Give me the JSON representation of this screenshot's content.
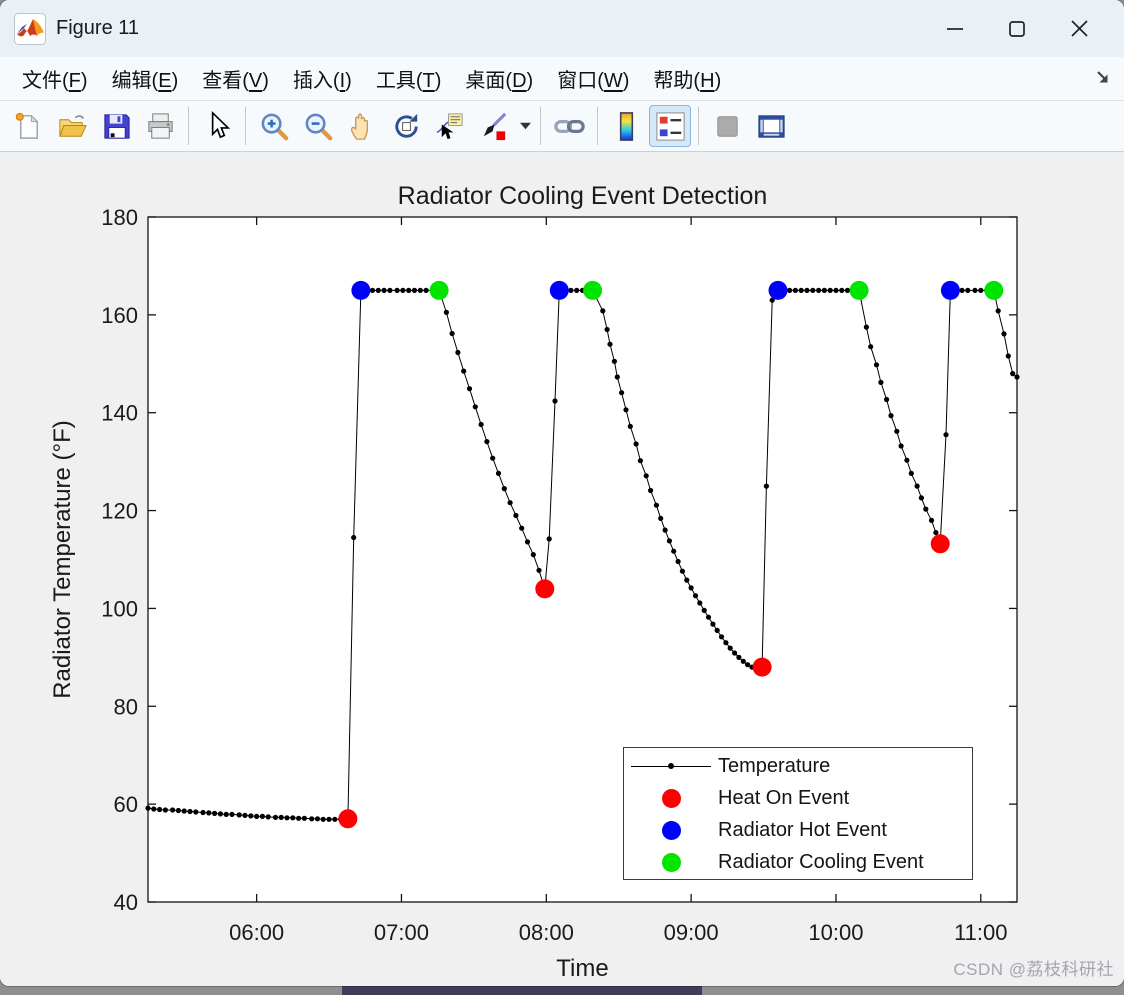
{
  "window": {
    "title": "Figure 11"
  },
  "menubar": {
    "items": [
      {
        "label": "文件(F)"
      },
      {
        "label": "编辑(E)"
      },
      {
        "label": "查看(V)"
      },
      {
        "label": "插入(I)"
      },
      {
        "label": "工具(T)"
      },
      {
        "label": "桌面(D)"
      },
      {
        "label": "窗口(W)"
      },
      {
        "label": "帮助(H)"
      }
    ]
  },
  "toolbar": {
    "items": [
      {
        "name": "new-figure-icon"
      },
      {
        "name": "open-file-icon"
      },
      {
        "name": "save-figure-icon"
      },
      {
        "name": "print-figure-icon"
      },
      {
        "type": "separator"
      },
      {
        "name": "edit-plot-cursor-icon"
      },
      {
        "type": "separator"
      },
      {
        "name": "zoom-in-icon"
      },
      {
        "name": "zoom-out-icon"
      },
      {
        "name": "pan-icon"
      },
      {
        "name": "rotate-3d-icon"
      },
      {
        "name": "data-cursor-icon"
      },
      {
        "name": "brush-data-icon"
      },
      {
        "name": "brush-dropdown-caret-icon",
        "narrow": true
      },
      {
        "type": "separator"
      },
      {
        "name": "link-plot-icon"
      },
      {
        "type": "separator"
      },
      {
        "name": "insert-colorbar-icon"
      },
      {
        "name": "insert-legend-icon",
        "selected": true
      },
      {
        "type": "separator"
      },
      {
        "name": "hide-plot-tools-icon",
        "disabled": true
      },
      {
        "name": "dock-figure-tools-icon"
      }
    ],
    "selected_highlight_color": "#d5e7f8"
  },
  "watermark": "CSDN @荔枝科研社",
  "chart_data": {
    "type": "line",
    "title": "Radiator Cooling Event Detection",
    "xlabel": "Time",
    "ylabel": "Radiator Temperature (°F)",
    "x_range_hours": [
      5.25,
      11.25
    ],
    "ylim": [
      40,
      180
    ],
    "grid": false,
    "legend_position": "lower-right-inside",
    "x_ticks": [
      {
        "hour": 6,
        "label": "06:00"
      },
      {
        "hour": 7,
        "label": "07:00"
      },
      {
        "hour": 8,
        "label": "08:00"
      },
      {
        "hour": 9,
        "label": "09:00"
      },
      {
        "hour": 10,
        "label": "10:00"
      },
      {
        "hour": 11,
        "label": "11:00"
      }
    ],
    "y_ticks": [
      40,
      60,
      80,
      100,
      120,
      140,
      160,
      180
    ],
    "series": [
      {
        "name": "Temperature",
        "type": "line-with-dots",
        "color": "#000000",
        "points": [
          [
            5.25,
            59.2
          ],
          [
            5.29,
            59.0
          ],
          [
            5.33,
            58.9
          ],
          [
            5.37,
            58.8
          ],
          [
            5.42,
            58.8
          ],
          [
            5.46,
            58.7
          ],
          [
            5.5,
            58.6
          ],
          [
            5.54,
            58.5
          ],
          [
            5.58,
            58.4
          ],
          [
            5.63,
            58.3
          ],
          [
            5.67,
            58.2
          ],
          [
            5.71,
            58.1
          ],
          [
            5.75,
            58.0
          ],
          [
            5.79,
            57.9
          ],
          [
            5.83,
            57.9
          ],
          [
            5.88,
            57.8
          ],
          [
            5.92,
            57.7
          ],
          [
            5.96,
            57.6
          ],
          [
            6.0,
            57.5
          ],
          [
            6.04,
            57.5
          ],
          [
            6.08,
            57.4
          ],
          [
            6.13,
            57.3
          ],
          [
            6.17,
            57.3
          ],
          [
            6.21,
            57.2
          ],
          [
            6.25,
            57.2
          ],
          [
            6.29,
            57.1
          ],
          [
            6.33,
            57.1
          ],
          [
            6.38,
            57.0
          ],
          [
            6.42,
            57.0
          ],
          [
            6.46,
            56.9
          ],
          [
            6.5,
            56.9
          ],
          [
            6.54,
            56.9
          ],
          [
            6.58,
            56.9
          ],
          [
            6.63,
            57.0
          ],
          [
            6.67,
            114.5
          ],
          [
            6.72,
            165
          ],
          [
            6.76,
            165
          ],
          [
            6.8,
            165
          ],
          [
            6.84,
            165
          ],
          [
            6.88,
            165
          ],
          [
            6.92,
            165
          ],
          [
            6.97,
            165
          ],
          [
            7.01,
            165
          ],
          [
            7.05,
            165
          ],
          [
            7.09,
            165
          ],
          [
            7.13,
            165
          ],
          [
            7.17,
            165
          ],
          [
            7.22,
            165
          ],
          [
            7.26,
            165
          ],
          [
            7.31,
            160.5
          ],
          [
            7.35,
            156.2
          ],
          [
            7.39,
            152.3
          ],
          [
            7.43,
            148.5
          ],
          [
            7.47,
            144.9
          ],
          [
            7.51,
            141.2
          ],
          [
            7.55,
            137.6
          ],
          [
            7.59,
            134.1
          ],
          [
            7.63,
            130.7
          ],
          [
            7.67,
            127.6
          ],
          [
            7.71,
            124.5
          ],
          [
            7.75,
            121.6
          ],
          [
            7.79,
            119.0
          ],
          [
            7.83,
            116.4
          ],
          [
            7.87,
            113.6
          ],
          [
            7.91,
            111.0
          ],
          [
            7.95,
            107.8
          ],
          [
            7.99,
            104.0
          ],
          [
            8.02,
            114.2
          ],
          [
            8.06,
            142.4
          ],
          [
            8.09,
            165
          ],
          [
            8.13,
            165
          ],
          [
            8.17,
            165
          ],
          [
            8.21,
            165
          ],
          [
            8.25,
            165
          ],
          [
            8.28,
            165
          ],
          [
            8.32,
            165
          ],
          [
            8.39,
            160.8
          ],
          [
            8.42,
            157.0
          ],
          [
            8.44,
            154.0
          ],
          [
            8.47,
            150.5
          ],
          [
            8.49,
            147.3
          ],
          [
            8.52,
            144.1
          ],
          [
            8.55,
            140.6
          ],
          [
            8.58,
            137.2
          ],
          [
            8.62,
            133.6
          ],
          [
            8.65,
            130.2
          ],
          [
            8.69,
            127.1
          ],
          [
            8.72,
            124.1
          ],
          [
            8.76,
            121.1
          ],
          [
            8.79,
            118.4
          ],
          [
            8.82,
            116.0
          ],
          [
            8.85,
            113.8
          ],
          [
            8.88,
            111.7
          ],
          [
            8.91,
            109.6
          ],
          [
            8.94,
            107.6
          ],
          [
            8.97,
            105.8
          ],
          [
            9.0,
            104.2
          ],
          [
            9.03,
            102.6
          ],
          [
            9.06,
            101.1
          ],
          [
            9.09,
            99.6
          ],
          [
            9.12,
            98.2
          ],
          [
            9.15,
            96.8
          ],
          [
            9.18,
            95.5
          ],
          [
            9.21,
            94.2
          ],
          [
            9.24,
            93.0
          ],
          [
            9.27,
            91.9
          ],
          [
            9.3,
            90.9
          ],
          [
            9.33,
            90.0
          ],
          [
            9.36,
            89.2
          ],
          [
            9.39,
            88.5
          ],
          [
            9.42,
            88.0
          ],
          [
            9.45,
            87.6
          ],
          [
            9.49,
            88.0
          ],
          [
            9.52,
            125.0
          ],
          [
            9.56,
            163.0
          ],
          [
            9.6,
            165
          ],
          [
            9.64,
            165
          ],
          [
            9.68,
            165
          ],
          [
            9.72,
            165
          ],
          [
            9.76,
            165
          ],
          [
            9.8,
            165
          ],
          [
            9.84,
            165
          ],
          [
            9.88,
            165
          ],
          [
            9.92,
            165
          ],
          [
            9.96,
            165
          ],
          [
            10.0,
            165
          ],
          [
            10.04,
            165
          ],
          [
            10.08,
            165
          ],
          [
            10.12,
            165
          ],
          [
            10.16,
            165
          ],
          [
            10.21,
            157.5
          ],
          [
            10.24,
            153.5
          ],
          [
            10.28,
            149.8
          ],
          [
            10.31,
            146.2
          ],
          [
            10.35,
            142.7
          ],
          [
            10.38,
            139.4
          ],
          [
            10.42,
            136.2
          ],
          [
            10.45,
            133.2
          ],
          [
            10.49,
            130.3
          ],
          [
            10.52,
            127.6
          ],
          [
            10.56,
            125.0
          ],
          [
            10.59,
            122.6
          ],
          [
            10.62,
            120.3
          ],
          [
            10.66,
            118.0
          ],
          [
            10.69,
            115.5
          ],
          [
            10.72,
            113.2
          ],
          [
            10.76,
            135.5
          ],
          [
            10.79,
            165
          ],
          [
            10.83,
            165
          ],
          [
            10.87,
            165
          ],
          [
            10.91,
            165
          ],
          [
            10.96,
            165
          ],
          [
            11.0,
            165
          ],
          [
            11.04,
            165
          ],
          [
            11.09,
            165
          ],
          [
            11.12,
            160.8
          ],
          [
            11.16,
            156.1
          ],
          [
            11.19,
            151.6
          ],
          [
            11.22,
            148.0
          ],
          [
            11.25,
            147.3
          ]
        ]
      },
      {
        "name": "Heat On Event",
        "type": "marker",
        "color": "#ff0000",
        "points": [
          [
            6.63,
            57.0
          ],
          [
            7.99,
            104.0
          ],
          [
            9.49,
            88.0
          ],
          [
            10.72,
            113.2
          ]
        ]
      },
      {
        "name": "Radiator Hot Event",
        "type": "marker",
        "color": "#0000ff",
        "points": [
          [
            6.72,
            165
          ],
          [
            8.09,
            165
          ],
          [
            9.6,
            165
          ],
          [
            10.79,
            165
          ]
        ]
      },
      {
        "name": "Radiator Cooling Event",
        "type": "marker",
        "color": "#00e400",
        "points": [
          [
            7.26,
            165
          ],
          [
            8.32,
            165
          ],
          [
            10.16,
            165
          ],
          [
            11.09,
            165
          ]
        ]
      }
    ]
  }
}
